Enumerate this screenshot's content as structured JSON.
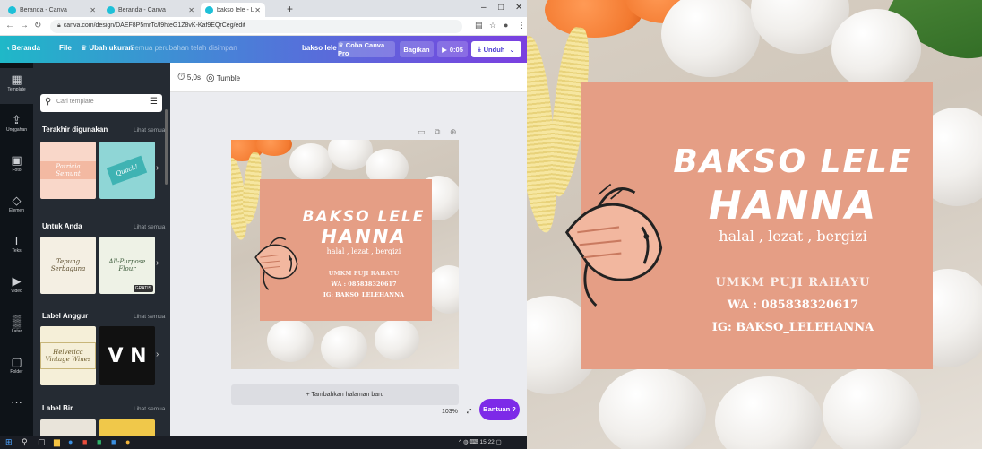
{
  "browser": {
    "tabs": [
      {
        "label": "Beranda - Canva",
        "active": false
      },
      {
        "label": "Beranda - Canva",
        "active": false
      },
      {
        "label": "bakso lele - Label",
        "active": true
      }
    ],
    "new_tab": "+",
    "window_controls": {
      "minimize": "–",
      "maximize": "□",
      "close": "✕"
    },
    "url": "canva.com/design/DAEF8P5mrTc/I9hteG1Z8vK-Kaf9EQrCeg/edit"
  },
  "topbar": {
    "back": "‹ Beranda",
    "file": "File",
    "resize": "♛ Ubah ukuran",
    "save_hint": "Semua perubahan telah disimpan",
    "design_name": "bakso lele",
    "try_pro": "♛ Coba Canva Pro",
    "share": "Bagikan",
    "present_time": "0:05",
    "download": "Unduh"
  },
  "rail": [
    {
      "icon": "▦",
      "label": "Template"
    },
    {
      "icon": "⇪",
      "label": "Unggahan"
    },
    {
      "icon": "▣",
      "label": "Foto"
    },
    {
      "icon": "◇",
      "label": "Elemen"
    },
    {
      "icon": "T",
      "label": "Teks"
    },
    {
      "icon": "▶",
      "label": "Video"
    },
    {
      "icon": "▒",
      "label": "Latar"
    },
    {
      "icon": "▢",
      "label": "Folder"
    },
    {
      "icon": "···",
      "label": ""
    }
  ],
  "panel": {
    "search_placeholder": "Cari template",
    "sections": [
      {
        "title": "Terakhir digunakan",
        "see_all": "Lihat semua",
        "thumbs": [
          "Patricia Semunt",
          "Quack!"
        ]
      },
      {
        "title": "Untuk Anda",
        "see_all": "Lihat semua",
        "thumbs": [
          "Tepung Serbaguna",
          "All-Purpose Flour"
        ],
        "badge": "GRATIS"
      },
      {
        "title": "Label Anggur",
        "see_all": "Lihat semua",
        "thumbs": [
          "Helvetica Vintage Wines",
          "V N"
        ]
      },
      {
        "title": "Label Bir",
        "see_all": "Lihat semua",
        "thumbs": []
      }
    ]
  },
  "toolbar": {
    "duration": "5,0s",
    "animation": "Tumble"
  },
  "canvas": {
    "add_page": "+ Tambahkan halaman baru",
    "zoom": "103%",
    "help": "Bantuan ?"
  },
  "taskbar": {
    "time": "15.22"
  },
  "design": {
    "title_line1": "BAKSO LELE",
    "title_line2": "HANNA",
    "tagline": "halal , lezat , bergizi",
    "owner": "UMKM PUJI RAHAYU",
    "wa": "WA : 085838320617",
    "ig": "IG: BAKSO_LELEHANNA"
  },
  "colors": {
    "card": "#e59e85",
    "canva_purple": "#7d2ae8",
    "dark_panel": "#252b33"
  }
}
